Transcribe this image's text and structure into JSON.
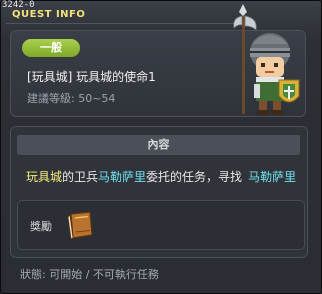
{
  "window": {
    "quest_code": "3242-0",
    "title": "QUEST INFO"
  },
  "quest": {
    "badge": "一般",
    "name": "[玩具城] 玩具城的使命1",
    "level": "建議等級: 50~54"
  },
  "content": {
    "header": "內容",
    "text_part1": "玩具城",
    "text_part2": "的卫兵",
    "text_part3": "马勒萨里",
    "text_part4": "委托的任务，寻找",
    "text_part5": "马勒萨里"
  },
  "reward": {
    "label": "獎勵",
    "item_icon": "book-icon"
  },
  "status": {
    "text": "狀態: 可開始 / 不可執行任務"
  },
  "colors": {
    "title": "#f3e27a",
    "badge": "#8fbb35",
    "highlight_place": "#f5f07a",
    "highlight_npc": "#6fe0ec"
  }
}
